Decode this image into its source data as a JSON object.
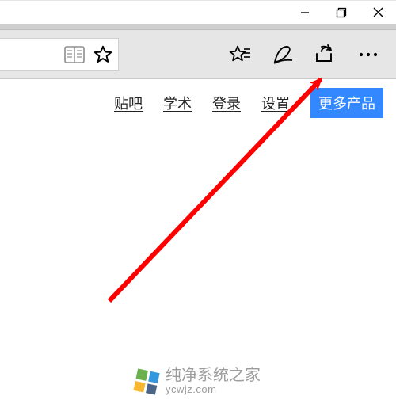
{
  "window": {
    "minimize_name": "minimize-icon",
    "maximize_name": "maximize-icon",
    "close_name": "close-icon"
  },
  "toolbar": {
    "reading_list_name": "reading-list-icon",
    "star_name": "favorite-star-icon",
    "add_fav_name": "add-favorite-star-icon",
    "notes_name": "web-notes-icon",
    "share_name": "share-icon",
    "more_name": "more-icon"
  },
  "nav": {
    "items": [
      {
        "label": "贴吧"
      },
      {
        "label": "学术"
      },
      {
        "label": "登录"
      },
      {
        "label": "设置"
      }
    ],
    "primary_label": "更多产品"
  },
  "watermark": {
    "title": "纯净系统之家",
    "subtitle": "ycwjz.com",
    "colors": [
      "#6ab04c",
      "#3498db",
      "#f7b731",
      "#4b6584"
    ]
  },
  "annotation": {
    "arrow_color": "#ff0000"
  }
}
